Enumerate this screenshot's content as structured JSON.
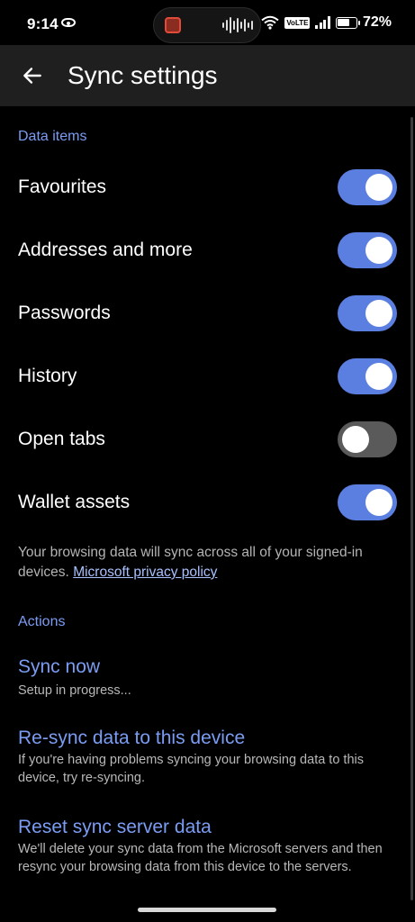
{
  "status_bar": {
    "time": "9:14",
    "battery": "72%",
    "volte": "VoLTE"
  },
  "app_bar": {
    "title": "Sync settings",
    "back_icon": "arrow-left-icon"
  },
  "data_items": {
    "header": "Data items",
    "items": [
      {
        "label": "Favourites",
        "enabled": true
      },
      {
        "label": "Addresses and more",
        "enabled": true
      },
      {
        "label": "Passwords",
        "enabled": true
      },
      {
        "label": "History",
        "enabled": true
      },
      {
        "label": "Open tabs",
        "enabled": false
      },
      {
        "label": "Wallet assets",
        "enabled": true
      }
    ],
    "note_text": "Your browsing data will sync across all of your signed-in devices.",
    "note_link": "Microsoft privacy policy"
  },
  "actions": {
    "header": "Actions",
    "sync_now": {
      "title": "Sync now",
      "subtitle": "Setup in progress..."
    },
    "resync": {
      "title": "Re-sync data to this device",
      "subtitle": "If you're having problems syncing your browsing data to this device, try re-syncing."
    },
    "reset": {
      "title": "Reset sync server data",
      "subtitle": "We'll delete your sync data from the Microsoft servers and then resync your browsing data from this device to the servers."
    }
  },
  "colors": {
    "accent": "#7b9cf3",
    "toggle_on": "#5b7fe0",
    "toggle_off": "#5a5a5a",
    "background": "#000000",
    "app_bar": "#1f1f1f"
  }
}
